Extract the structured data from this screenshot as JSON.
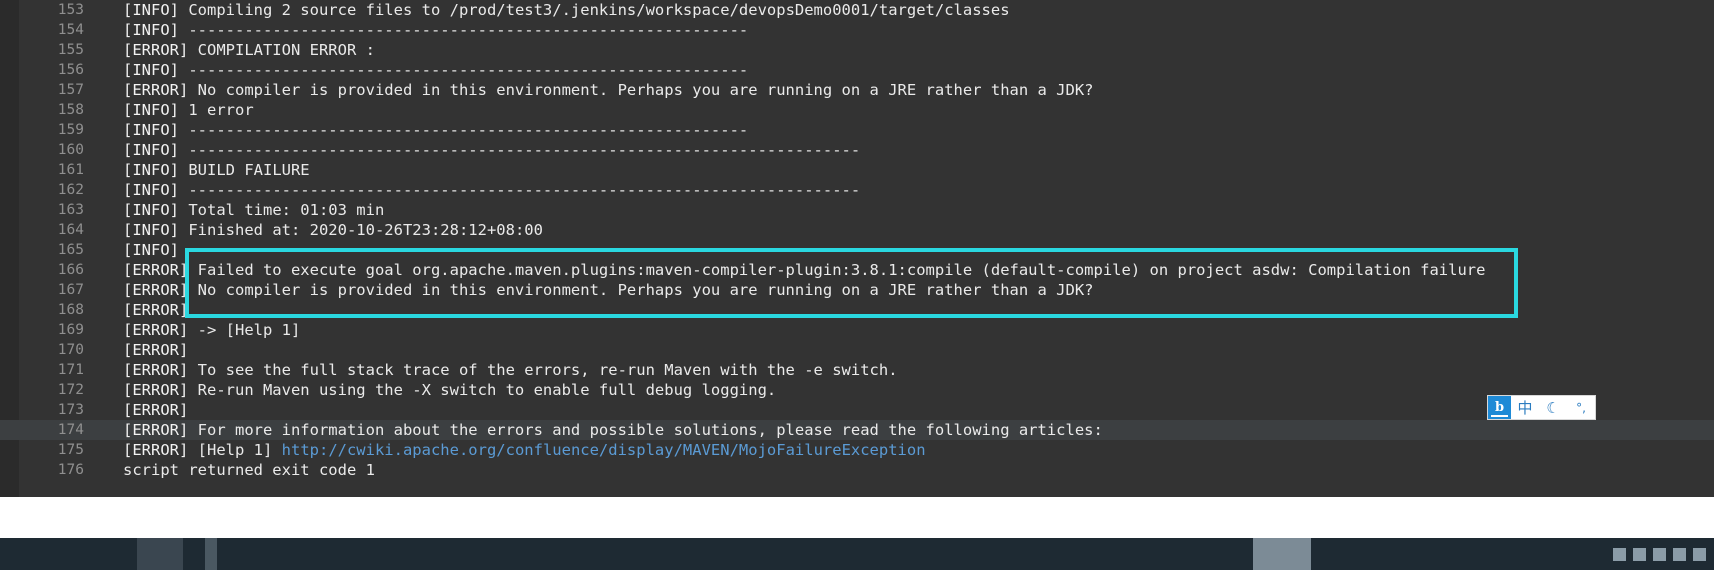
{
  "console": {
    "background": "#333333",
    "gutter_color": "#8f8f8f",
    "text_color": "#e8e8e8",
    "link_color": "#5b9bd5",
    "lines": [
      {
        "no": "153",
        "segments": [
          {
            "cls": "tag",
            "text": "[INFO] "
          },
          {
            "cls": "msg",
            "text": "Compiling 2 source files to /prod/test3/.jenkins/workspace/devopsDemo0001/target/classes"
          }
        ]
      },
      {
        "no": "154",
        "segments": [
          {
            "cls": "tag",
            "text": "[INFO] "
          },
          {
            "cls": "dashes",
            "text": "------------------------------------------------------------"
          }
        ]
      },
      {
        "no": "155",
        "segments": [
          {
            "cls": "tag",
            "text": "[ERROR] "
          },
          {
            "cls": "msg",
            "text": "COMPILATION ERROR :"
          }
        ]
      },
      {
        "no": "156",
        "segments": [
          {
            "cls": "tag",
            "text": "[INFO] "
          },
          {
            "cls": "dashes",
            "text": "------------------------------------------------------------"
          }
        ]
      },
      {
        "no": "157",
        "segments": [
          {
            "cls": "tag",
            "text": "[ERROR] "
          },
          {
            "cls": "msg",
            "text": "No compiler is provided in this environment. Perhaps you are running on a JRE rather than a JDK?"
          }
        ]
      },
      {
        "no": "158",
        "segments": [
          {
            "cls": "tag",
            "text": "[INFO] "
          },
          {
            "cls": "msg",
            "text": "1 error"
          }
        ]
      },
      {
        "no": "159",
        "segments": [
          {
            "cls": "tag",
            "text": "[INFO] "
          },
          {
            "cls": "dashes",
            "text": "------------------------------------------------------------"
          }
        ]
      },
      {
        "no": "160",
        "segments": [
          {
            "cls": "tag",
            "text": "[INFO] "
          },
          {
            "cls": "dashes",
            "text": "------------------------------------------------------------------------"
          }
        ]
      },
      {
        "no": "161",
        "segments": [
          {
            "cls": "tag",
            "text": "[INFO] "
          },
          {
            "cls": "msg",
            "text": "BUILD FAILURE"
          }
        ]
      },
      {
        "no": "162",
        "segments": [
          {
            "cls": "tag",
            "text": "[INFO] "
          },
          {
            "cls": "dashes",
            "text": "------------------------------------------------------------------------"
          }
        ]
      },
      {
        "no": "163",
        "segments": [
          {
            "cls": "tag",
            "text": "[INFO] "
          },
          {
            "cls": "msg",
            "text": "Total time: 01:03 min"
          }
        ]
      },
      {
        "no": "164",
        "segments": [
          {
            "cls": "tag",
            "text": "[INFO] "
          },
          {
            "cls": "msg",
            "text": "Finished at: 2020-10-26T23:28:12+08:00"
          }
        ]
      },
      {
        "no": "165",
        "segments": [
          {
            "cls": "tag",
            "text": "[INFO] "
          }
        ]
      },
      {
        "no": "166",
        "segments": [
          {
            "cls": "tag",
            "text": "[ERROR] "
          },
          {
            "cls": "msg",
            "text": "Failed to execute goal org.apache.maven.plugins:maven-compiler-plugin:3.8.1:compile (default-compile) on project asdw: Compilation failure"
          }
        ]
      },
      {
        "no": "167",
        "segments": [
          {
            "cls": "tag",
            "text": "[ERROR] "
          },
          {
            "cls": "msg",
            "text": "No compiler is provided in this environment. Perhaps you are running on a JRE rather than a JDK?"
          }
        ]
      },
      {
        "no": "168",
        "segments": [
          {
            "cls": "tag",
            "text": "[ERROR] "
          }
        ]
      },
      {
        "no": "169",
        "segments": [
          {
            "cls": "tag",
            "text": "[ERROR] "
          },
          {
            "cls": "msg",
            "text": "-> [Help 1]"
          }
        ]
      },
      {
        "no": "170",
        "segments": [
          {
            "cls": "tag",
            "text": "[ERROR] "
          }
        ]
      },
      {
        "no": "171",
        "segments": [
          {
            "cls": "tag",
            "text": "[ERROR] "
          },
          {
            "cls": "msg",
            "text": "To see the full stack trace of the errors, re-run Maven with the -e switch."
          }
        ]
      },
      {
        "no": "172",
        "segments": [
          {
            "cls": "tag",
            "text": "[ERROR] "
          },
          {
            "cls": "msg",
            "text": "Re-run Maven using the -X switch to enable full debug logging."
          }
        ]
      },
      {
        "no": "173",
        "segments": [
          {
            "cls": "tag",
            "text": "[ERROR] "
          }
        ]
      },
      {
        "no": "174",
        "highlight": true,
        "segments": [
          {
            "cls": "tag",
            "text": "[ERROR] "
          },
          {
            "cls": "msg",
            "text": "For more information about the errors and possible solutions, please read the following articles:"
          }
        ]
      },
      {
        "no": "175",
        "segments": [
          {
            "cls": "tag",
            "text": "[ERROR] "
          },
          {
            "cls": "msg",
            "text": "[Help 1] "
          },
          {
            "cls": "link",
            "text": "http://cwiki.apache.org/confluence/display/MAVEN/MojoFailureException"
          }
        ]
      },
      {
        "no": "176",
        "segments": [
          {
            "cls": "msg",
            "text": "script returned exit code 1"
          }
        ]
      }
    ]
  },
  "annotation": {
    "name": "error-highlight-box",
    "color": "#2ad8e0",
    "covers_lines": "166-167"
  },
  "ime": {
    "logo_glyph": "b",
    "mode_label": "中",
    "shape_label": "☾",
    "punctuation_label": "°,"
  }
}
